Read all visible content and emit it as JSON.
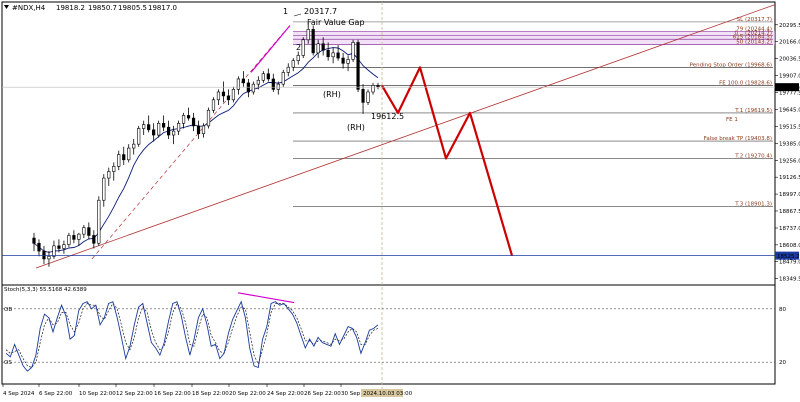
{
  "chart_data": {
    "type": "candlestick",
    "title": "#NDX,H4",
    "ohlc": {
      "open": "19818.2",
      "high": "19850.7",
      "low": "19805.5",
      "close": "19817.0"
    },
    "colors": {
      "bull": "#000000",
      "bear": "#000000",
      "ma": "#0a1a7a",
      "trend": "#b03030",
      "projection": "#cc0000",
      "divergence": "#d000d0",
      "stoch_main": "#1a3aa0",
      "stoch_signal": "#1a1a1a",
      "current_price_bg": "#000000",
      "target_bg": "#1a3aa0"
    },
    "y_range": [
      18300,
      20470
    ],
    "y_ticks": [
      "20295.5",
      "20166.0",
      "20036.5",
      "19907.0",
      "19777.5",
      "19645.0",
      "19515.5",
      "19385.0",
      "19256.0",
      "19126.5",
      "18997.0",
      "18867.5",
      "18737.0",
      "18608.0",
      "18479.0",
      "18349.5"
    ],
    "current_price": "19817.0",
    "target_price": "18525.2",
    "x_ticks": [
      "4 Sep 2024",
      "6 Sep 22:00",
      "10 Sep 22:00",
      "12 Sep 22:00",
      "16 Sep 22:00",
      "18 Sep 22:00",
      "20 Sep 22:00",
      "24 Sep 22:00",
      "26 Sep 22:00",
      "30 Sep 22:00"
    ],
    "x_current_label": "2024.10.03 03:00",
    "candles": [
      [
        18660,
        18700,
        18560,
        18620
      ],
      [
        18620,
        18650,
        18520,
        18560
      ],
      [
        18560,
        18600,
        18460,
        18500
      ],
      [
        18500,
        18560,
        18440,
        18520
      ],
      [
        18520,
        18640,
        18500,
        18600
      ],
      [
        18600,
        18650,
        18550,
        18580
      ],
      [
        18580,
        18640,
        18540,
        18610
      ],
      [
        18610,
        18700,
        18590,
        18680
      ],
      [
        18680,
        18720,
        18620,
        18650
      ],
      [
        18650,
        18700,
        18600,
        18690
      ],
      [
        18690,
        18760,
        18660,
        18740
      ],
      [
        18740,
        18780,
        18650,
        18680
      ],
      [
        18680,
        18720,
        18580,
        18620
      ],
      [
        18620,
        18980,
        18600,
        18950
      ],
      [
        18950,
        19150,
        18900,
        19120
      ],
      [
        19120,
        19200,
        19060,
        19170
      ],
      [
        19170,
        19240,
        19100,
        19210
      ],
      [
        19210,
        19330,
        19180,
        19300
      ],
      [
        19300,
        19360,
        19220,
        19260
      ],
      [
        19260,
        19380,
        19240,
        19350
      ],
      [
        19350,
        19420,
        19300,
        19380
      ],
      [
        19380,
        19520,
        19360,
        19500
      ],
      [
        19500,
        19560,
        19450,
        19530
      ],
      [
        19530,
        19600,
        19470,
        19490
      ],
      [
        19490,
        19540,
        19400,
        19450
      ],
      [
        19450,
        19560,
        19430,
        19540
      ],
      [
        19540,
        19600,
        19480,
        19510
      ],
      [
        19510,
        19560,
        19420,
        19450
      ],
      [
        19450,
        19520,
        19380,
        19480
      ],
      [
        19480,
        19560,
        19450,
        19540
      ],
      [
        19540,
        19620,
        19500,
        19600
      ],
      [
        19600,
        19660,
        19560,
        19580
      ],
      [
        19580,
        19620,
        19480,
        19520
      ],
      [
        19520,
        19560,
        19420,
        19460
      ],
      [
        19460,
        19540,
        19430,
        19520
      ],
      [
        19520,
        19660,
        19500,
        19640
      ],
      [
        19640,
        19740,
        19620,
        19720
      ],
      [
        19720,
        19800,
        19680,
        19780
      ],
      [
        19780,
        19860,
        19700,
        19750
      ],
      [
        19750,
        19800,
        19680,
        19720
      ],
      [
        19720,
        19820,
        19700,
        19800
      ],
      [
        19800,
        19900,
        19760,
        19880
      ],
      [
        19880,
        19940,
        19820,
        19850
      ],
      [
        19850,
        19880,
        19740,
        19780
      ],
      [
        19780,
        19860,
        19760,
        19840
      ],
      [
        19840,
        19900,
        19800,
        19870
      ],
      [
        19870,
        19940,
        19850,
        19920
      ],
      [
        19920,
        19960,
        19860,
        19880
      ],
      [
        19880,
        19920,
        19780,
        19800
      ],
      [
        19800,
        19860,
        19760,
        19840
      ],
      [
        19840,
        19950,
        19820,
        19930
      ],
      [
        19930,
        20000,
        19900,
        19970
      ],
      [
        19970,
        20040,
        19940,
        20020
      ],
      [
        20020,
        20090,
        19990,
        20060
      ],
      [
        20060,
        20200,
        20040,
        20180
      ],
      [
        20180,
        20317.7,
        20150,
        20260
      ],
      [
        20260,
        20290,
        20060,
        20080
      ],
      [
        20080,
        20180,
        20040,
        20150
      ],
      [
        20150,
        20200,
        20060,
        20100
      ],
      [
        20100,
        20160,
        20020,
        20050
      ],
      [
        20050,
        20120,
        20000,
        20080
      ],
      [
        20080,
        20140,
        20020,
        20040
      ],
      [
        20040,
        20080,
        19960,
        20000
      ],
      [
        20000,
        20060,
        19940,
        20030
      ],
      [
        20030,
        20180,
        20010,
        20160
      ],
      [
        20160,
        20180,
        19780,
        19800
      ],
      [
        19800,
        19840,
        19612.5,
        19700
      ],
      [
        19700,
        19800,
        19680,
        19780
      ],
      [
        19780,
        19850,
        19760,
        19830
      ],
      [
        19830,
        19850,
        19800,
        19817
      ]
    ],
    "levels": [
      {
        "label": "SL (20317.7)",
        "price": 20317.7,
        "color": "#888888"
      },
      {
        "label": "79 (20244.4)",
        "price": 20244.4,
        "color": "#9040a0"
      },
      {
        "label": "0 ...(20214.7)",
        "price": 20214.7,
        "color": "#9040a0"
      },
      {
        "label": "615 (20184.3)",
        "price": 20184.3,
        "color": "#9040a0"
      },
      {
        "label": "50 (20143.2)",
        "price": 20143.2,
        "color": "#9040a0"
      },
      {
        "label": "Pending Stop Order (19968.6)",
        "price": 19968.6,
        "color": "#444444"
      },
      {
        "label": "FE 100.0 (19828.6)",
        "price": 19828.6,
        "color": "#444444"
      },
      {
        "label": "T.1 (19619.5)",
        "price": 19619.5,
        "color": "#444444"
      },
      {
        "label": "False break TP (19403.8)",
        "price": 19403.8,
        "color": "#444444"
      },
      {
        "label": "T.2 (19270.4)",
        "price": 19270.4,
        "color": "#444444"
      },
      {
        "label": "T.3 (18901.3)",
        "price": 18901.3,
        "color": "#444444"
      }
    ],
    "annotations": [
      "20317.7",
      "Fair Value Gap",
      "1",
      "2",
      "(RH)",
      "(RH)",
      "19612.5",
      "FE 1"
    ],
    "projection_path": [
      19828.6,
      19620,
      19968.6,
      19270.4,
      19619.5,
      18525.2
    ],
    "stoch": {
      "label": "Stoch(5,3,3) 55.5168 42.6389",
      "levels": [
        80,
        20
      ],
      "level_labels": [
        "80",
        "20"
      ],
      "side_labels": [
        "OB",
        "OS"
      ],
      "k": [
        30,
        26,
        40,
        28,
        16,
        10,
        14,
        28,
        58,
        74,
        70,
        54,
        70,
        84,
        72,
        46,
        50,
        78,
        86,
        88,
        80,
        84,
        62,
        70,
        86,
        88,
        70,
        48,
        24,
        38,
        62,
        82,
        86,
        64,
        42,
        36,
        28,
        42,
        66,
        86,
        88,
        72,
        48,
        28,
        46,
        70,
        80,
        62,
        38,
        40,
        24,
        30,
        52,
        68,
        78,
        88,
        70,
        36,
        16,
        14,
        46,
        60,
        86,
        88,
        84,
        86,
        80,
        74,
        64,
        50,
        36,
        46,
        38,
        48,
        42,
        40,
        38,
        52,
        40,
        50,
        60,
        58,
        48,
        30,
        42,
        56,
        58,
        62
      ],
      "d": [
        34,
        30,
        32,
        34,
        24,
        16,
        14,
        20,
        42,
        62,
        70,
        62,
        64,
        76,
        76,
        62,
        54,
        64,
        80,
        86,
        84,
        84,
        72,
        68,
        78,
        86,
        80,
        62,
        42,
        34,
        48,
        70,
        82,
        76,
        56,
        42,
        34,
        38,
        54,
        76,
        86,
        80,
        64,
        40,
        38,
        58,
        74,
        70,
        50,
        42,
        32,
        30,
        42,
        58,
        72,
        82,
        80,
        54,
        28,
        18,
        34,
        52,
        76,
        86,
        86,
        86,
        82,
        78,
        70,
        58,
        44,
        44,
        40,
        44,
        44,
        42,
        40,
        46,
        44,
        46,
        54,
        58,
        54,
        40,
        40,
        50,
        56,
        58
      ]
    }
  }
}
